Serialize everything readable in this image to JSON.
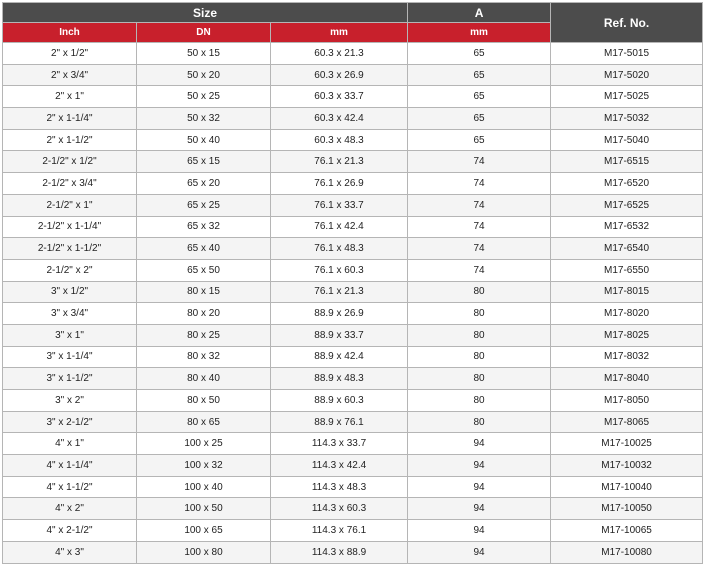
{
  "table": {
    "group_headers": {
      "size": "Size",
      "a": "A",
      "ref": "Ref. No."
    },
    "sub_headers": {
      "inch": "Inch",
      "dn": "DN",
      "mm": "mm",
      "a_mm": "mm"
    },
    "rows": [
      [
        "2\" x 1/2\"",
        "50 x 15",
        "60.3 x 21.3",
        "65",
        "M17-5015"
      ],
      [
        "2\" x 3/4\"",
        "50 x 20",
        "60.3 x 26.9",
        "65",
        "M17-5020"
      ],
      [
        "2\" x 1\"",
        "50 x 25",
        "60.3 x 33.7",
        "65",
        "M17-5025"
      ],
      [
        "2\" x 1-1/4\"",
        "50 x 32",
        "60.3 x 42.4",
        "65",
        "M17-5032"
      ],
      [
        "2\" x 1-1/2\"",
        "50 x 40",
        "60.3 x 48.3",
        "65",
        "M17-5040"
      ],
      [
        "2-1/2\" x 1/2\"",
        "65 x 15",
        "76.1 x 21.3",
        "74",
        "M17-6515"
      ],
      [
        "2-1/2\" x 3/4\"",
        "65 x 20",
        "76.1 x 26.9",
        "74",
        "M17-6520"
      ],
      [
        "2-1/2\" x 1\"",
        "65 x 25",
        "76.1 x 33.7",
        "74",
        "M17-6525"
      ],
      [
        "2-1/2\" x 1-1/4\"",
        "65 x 32",
        "76.1 x 42.4",
        "74",
        "M17-6532"
      ],
      [
        "2-1/2\" x 1-1/2\"",
        "65 x 40",
        "76.1 x 48.3",
        "74",
        "M17-6540"
      ],
      [
        "2-1/2\" x 2\"",
        "65 x 50",
        "76.1 x 60.3",
        "74",
        "M17-6550"
      ],
      [
        "3\" x 1/2\"",
        "80 x 15",
        "76.1 x 21.3",
        "80",
        "M17-8015"
      ],
      [
        "3\" x 3/4\"",
        "80 x 20",
        "88.9 x 26.9",
        "80",
        "M17-8020"
      ],
      [
        "3\" x 1\"",
        "80 x 25",
        "88.9 x 33.7",
        "80",
        "M17-8025"
      ],
      [
        "3\" x 1-1/4\"",
        "80 x 32",
        "88.9 x 42.4",
        "80",
        "M17-8032"
      ],
      [
        "3\" x 1-1/2\"",
        "80 x 40",
        "88.9 x 48.3",
        "80",
        "M17-8040"
      ],
      [
        "3\" x 2\"",
        "80 x 50",
        "88.9 x 60.3",
        "80",
        "M17-8050"
      ],
      [
        "3\" x 2-1/2\"",
        "80 x 65",
        "88.9 x 76.1",
        "80",
        "M17-8065"
      ],
      [
        "4\" x 1\"",
        "100 x 25",
        "114.3 x 33.7",
        "94",
        "M17-10025"
      ],
      [
        "4\" x 1-1/4\"",
        "100 x 32",
        "114.3 x 42.4",
        "94",
        "M17-10032"
      ],
      [
        "4\" x 1-1/2\"",
        "100 x 40",
        "114.3 x 48.3",
        "94",
        "M17-10040"
      ],
      [
        "4\" x 2\"",
        "100 x 50",
        "114.3 x 60.3",
        "94",
        "M17-10050"
      ],
      [
        "4\" x 2-1/2\"",
        "100 x 65",
        "114.3 x 76.1",
        "94",
        "M17-10065"
      ],
      [
        "4\" x 3\"",
        "100 x 80",
        "114.3 x 88.9",
        "94",
        "M17-10080"
      ]
    ]
  },
  "colors": {
    "header_dark": "#4c4c4c",
    "header_red": "#c8202c",
    "border": "#b5b5b5"
  }
}
